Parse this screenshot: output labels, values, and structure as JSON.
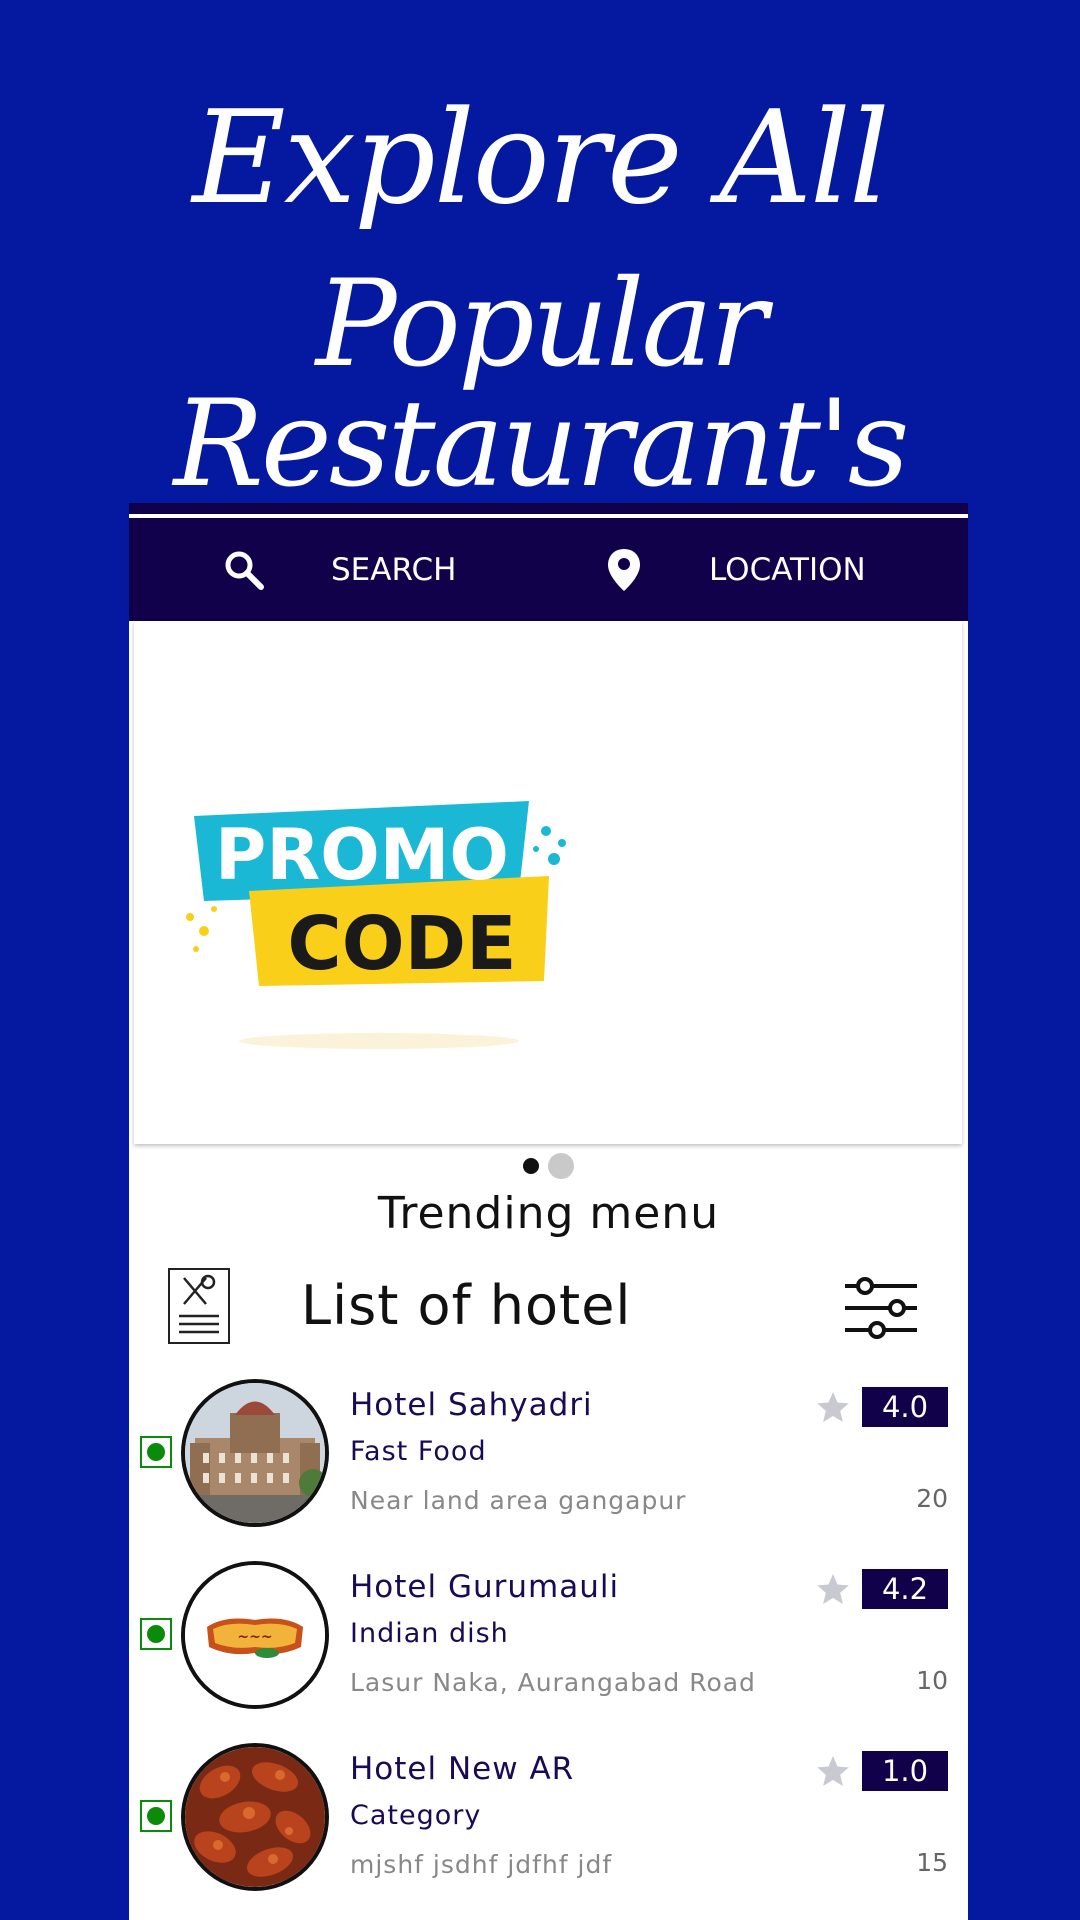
{
  "hero": {
    "line1": "Explore All",
    "line2": "Popular Restaurant's"
  },
  "topbar": {
    "search_label": "SEARCH",
    "location_label": "LOCATION"
  },
  "banner": {
    "promo_top": "PROMO",
    "promo_bottom": "CODE",
    "slides": 2,
    "active_slide": 1
  },
  "trending_title": "Trending menu",
  "list_title": "List of hotel",
  "hotels": [
    {
      "name": "Hotel Sahyadri",
      "category": "Fast Food",
      "address": "Near land area gangapur",
      "rating": "4.0",
      "count": "20",
      "image": "palace-photo"
    },
    {
      "name": "Hotel Gurumauli",
      "category": "Indian dish",
      "address": "Lasur Naka, Aurangabad Road",
      "rating": "4.2",
      "count": "10",
      "image": "restaurant-logo"
    },
    {
      "name": "Hotel New AR",
      "category": "Category",
      "address": "mjshf jsdhf jdfhf jdf",
      "rating": "1.0",
      "count": "15",
      "image": "fried-chicken-photo"
    }
  ],
  "colors": {
    "background": "#0419a0",
    "header": "#11004a",
    "veg": "#0a8c0a",
    "promo_cyan": "#1ab8d4",
    "promo_yellow": "#f9cf1a"
  },
  "icons": [
    "search-icon",
    "location-pin-icon",
    "menu-card-icon",
    "filter-sliders-icon",
    "star-icon",
    "veg-indicator-icon"
  ]
}
